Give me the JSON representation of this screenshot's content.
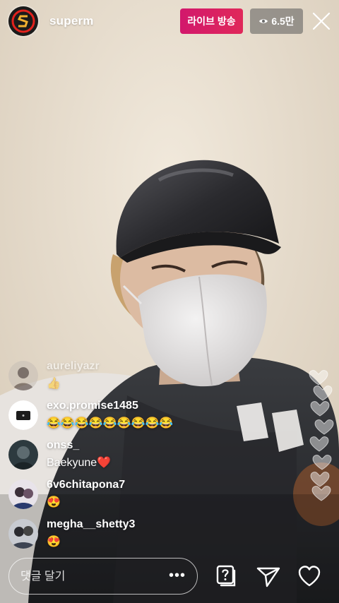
{
  "header": {
    "username": "superm",
    "live_label": "라이브 방송",
    "viewer_count": "6.5만"
  },
  "comments": [
    {
      "user": "aureliyazr",
      "text": "👍"
    },
    {
      "user": "exo.promise1485",
      "text": "😂😂😂😂😂😂😂😂😂"
    },
    {
      "user": "onss_",
      "text": "Baekyune❤️"
    },
    {
      "user": "6v6chitapona7",
      "text": "😍"
    },
    {
      "user": "megha__shetty3",
      "text": "😍"
    }
  ],
  "comment_input": {
    "placeholder": "댓글 달기",
    "more_label": "•••"
  },
  "icons": {
    "viewer": "eye-icon",
    "close": "close-icon",
    "question": "question-box-icon",
    "send": "paper-plane-icon",
    "like": "heart-icon"
  },
  "colors": {
    "live_badge": "#d2186c",
    "viewer_badge": "#5a5a5a"
  }
}
